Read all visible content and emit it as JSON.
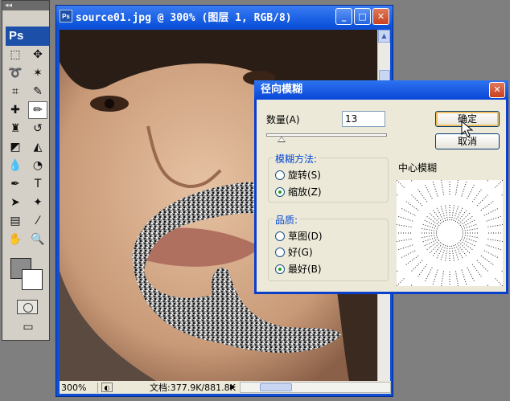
{
  "toolbox": {
    "logo": "Ps",
    "tools": [
      {
        "name": "marquee-tool-icon",
        "glyph": "⬚"
      },
      {
        "name": "move-tool-icon",
        "glyph": "✥"
      },
      {
        "name": "lasso-tool-icon",
        "glyph": "➰"
      },
      {
        "name": "magic-wand-tool-icon",
        "glyph": "✶"
      },
      {
        "name": "crop-tool-icon",
        "glyph": "⌗"
      },
      {
        "name": "slice-tool-icon",
        "glyph": "✎"
      },
      {
        "name": "healing-brush-tool-icon",
        "glyph": "✚"
      },
      {
        "name": "brush-tool-icon",
        "glyph": "✏"
      },
      {
        "name": "clone-stamp-tool-icon",
        "glyph": "♜"
      },
      {
        "name": "history-brush-tool-icon",
        "glyph": "↺"
      },
      {
        "name": "eraser-tool-icon",
        "glyph": "◩"
      },
      {
        "name": "paint-bucket-tool-icon",
        "glyph": "◭"
      },
      {
        "name": "blur-tool-icon",
        "glyph": "💧"
      },
      {
        "name": "dodge-tool-icon",
        "glyph": "◔"
      },
      {
        "name": "pen-tool-icon",
        "glyph": "✒"
      },
      {
        "name": "type-tool-icon",
        "glyph": "T"
      },
      {
        "name": "path-selection-tool-icon",
        "glyph": "➤"
      },
      {
        "name": "custom-shape-tool-icon",
        "glyph": "✦"
      },
      {
        "name": "notes-tool-icon",
        "glyph": "▤"
      },
      {
        "name": "eyedropper-tool-icon",
        "glyph": "⁄"
      },
      {
        "name": "hand-tool-icon",
        "glyph": "✋"
      },
      {
        "name": "zoom-tool-icon",
        "glyph": "🔍"
      }
    ]
  },
  "document": {
    "title": "source01.jpg @ 300% (图层 1, RGB/8)",
    "zoom": "300%",
    "doc_info": "文档:377.9K/881.8K",
    "minimize_label": "_",
    "maximize_label": "□",
    "close_label": "✕"
  },
  "dialog": {
    "title": "径向模糊",
    "close_label": "✕",
    "amount_label": "数量(A)",
    "amount_value": "13",
    "ok_label": "确定",
    "cancel_label": "取消",
    "blur_method": {
      "title": "模糊方法:",
      "options": [
        {
          "label": "旋转(S)",
          "selected": false
        },
        {
          "label": "缩放(Z)",
          "selected": true
        }
      ]
    },
    "quality": {
      "title": "品质:",
      "options": [
        {
          "label": "草图(D)",
          "selected": false
        },
        {
          "label": "好(G)",
          "selected": false
        },
        {
          "label": "最好(B)",
          "selected": true
        }
      ]
    },
    "center_label": "中心模糊"
  }
}
